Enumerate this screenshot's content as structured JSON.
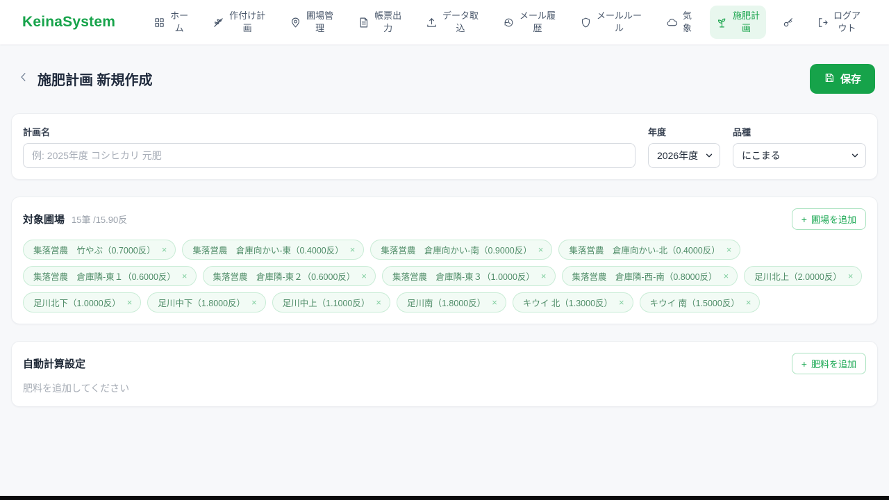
{
  "brand": "KeinaSystem",
  "glyphs": {
    "plus": "+",
    "close": "×"
  },
  "nav": {
    "items": [
      {
        "label": "ホー\nム",
        "icon": "grid-icon"
      },
      {
        "label": "作付け計\n画",
        "icon": "wheat-icon"
      },
      {
        "label": "圃場管\n理",
        "icon": "map-pin-icon"
      },
      {
        "label": "帳票出\n力",
        "icon": "document-icon"
      },
      {
        "label": "データ取\n込",
        "icon": "upload-icon"
      },
      {
        "label": "メール履\n歴",
        "icon": "history-icon"
      },
      {
        "label": "メールルー\nル",
        "icon": "shield-icon"
      },
      {
        "label": "気\n象",
        "icon": "cloud-icon"
      },
      {
        "label": "施肥計\n画",
        "icon": "sprout-icon",
        "active": true
      },
      {
        "label": "",
        "icon": "key-icon"
      },
      {
        "label": "ログア\nウト",
        "icon": "logout-icon"
      }
    ]
  },
  "header": {
    "title": "施肥計画 新規作成",
    "save_label": "保存"
  },
  "form": {
    "plan_name_label": "計画名",
    "plan_name_placeholder": "例: 2025年度 コシヒカリ 元肥",
    "year_label": "年度",
    "year_value": "2026年度",
    "variety_label": "品種",
    "variety_value": "にこまる"
  },
  "fields_section": {
    "title": "対象圃場",
    "summary": "15筆 /15.90反",
    "add_button_label": "圃場を追加",
    "tags": [
      "集落営農　竹やぶ（0.7000反）",
      "集落営農　倉庫向かい-東（0.4000反）",
      "集落営農　倉庫向かい-南（0.9000反）",
      "集落営農　倉庫向かい-北（0.4000反）",
      "集落営農　倉庫隣-東１（0.6000反）",
      "集落営農　倉庫隣-東２（0.6000反）",
      "集落営農　倉庫隣-東３（1.0000反）",
      "集落営農　倉庫隣-西-南（0.8000反）",
      "足川北上（2.0000反）",
      "足川北下（1.0000反）",
      "足川中下（1.8000反）",
      "足川中上（1.1000反）",
      "足川南（1.8000反）",
      "キウイ 北（1.3000反）",
      "キウイ 南（1.5000反）"
    ]
  },
  "auto_calc_section": {
    "title": "自動計算設定",
    "add_button_label": "肥料を追加",
    "empty_message": "肥料を追加してください"
  },
  "colors": {
    "brand_green": "#16a34a",
    "active_nav_bg": "#e8f7ee",
    "tag_bg": "#f2fbf5",
    "tag_text": "#4e8c67"
  }
}
